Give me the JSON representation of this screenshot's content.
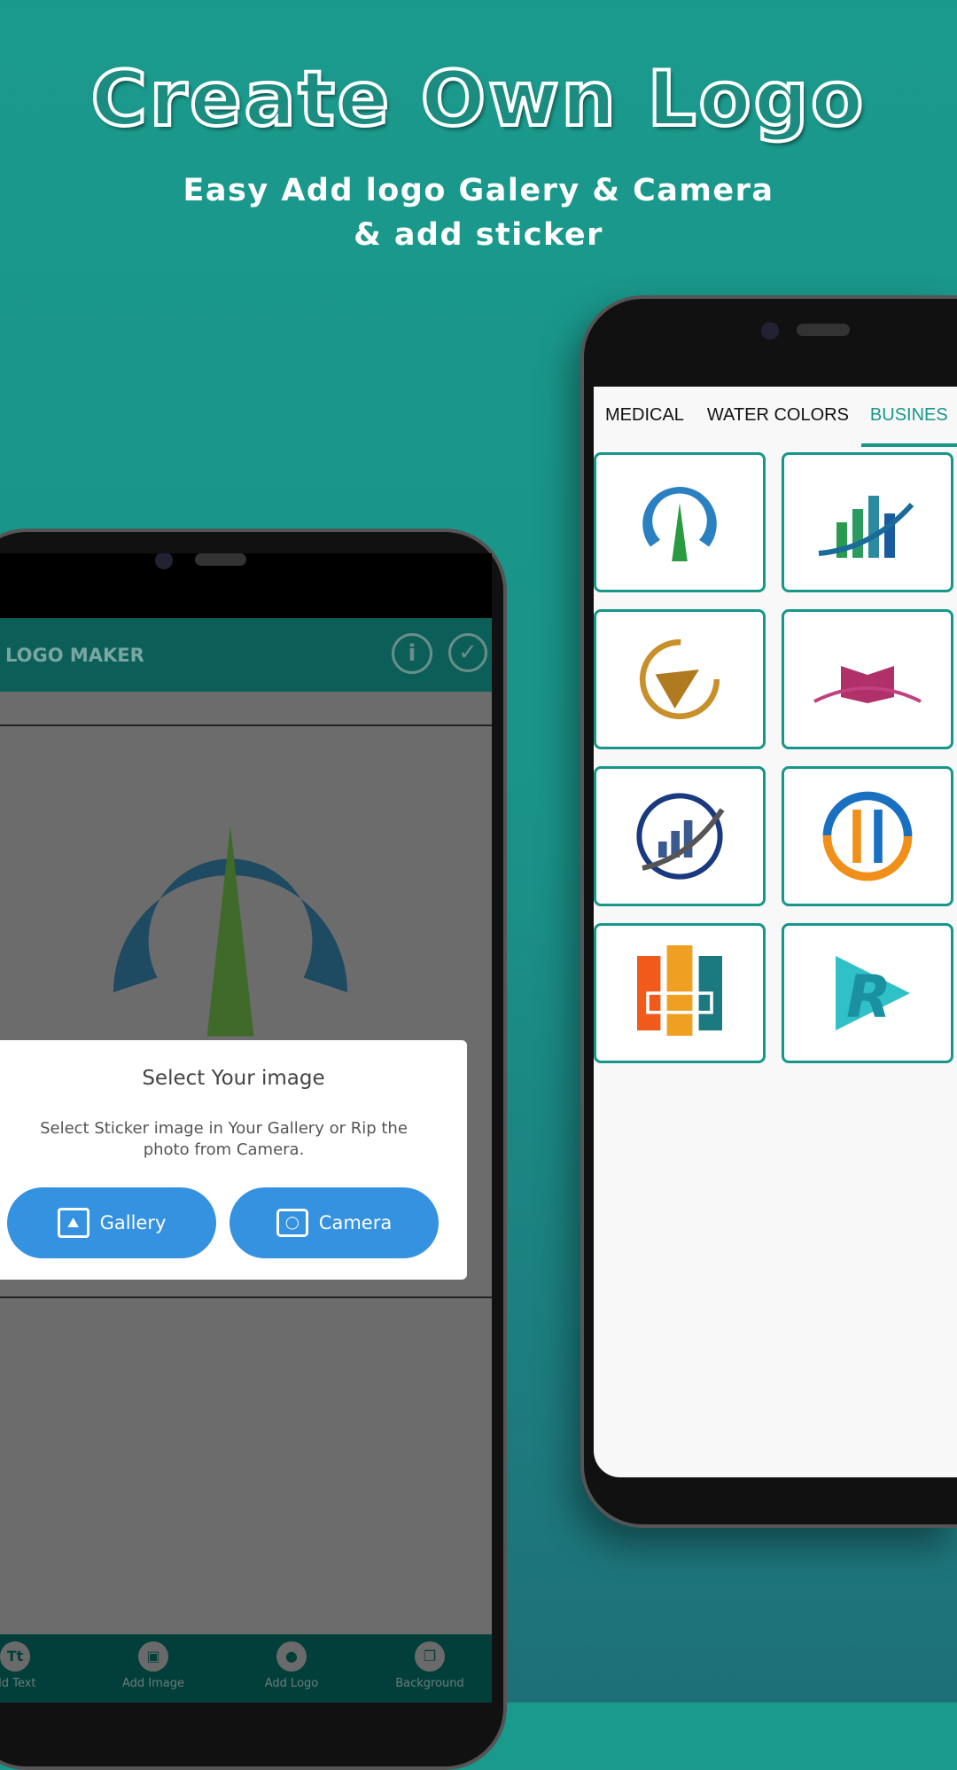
{
  "headline": "Create Own Logo",
  "subtitle_line1": "Easy Add logo Galery & Camera",
  "subtitle_line2": "& add sticker",
  "right_phone": {
    "tabs": [
      {
        "label": "MEDICAL"
      },
      {
        "label": "WATER COLORS"
      },
      {
        "label": "BUSINES"
      }
    ],
    "active_tab": "BUSINES",
    "accent": "#17978a"
  },
  "left_phone": {
    "app_title": "LOGO MAKER",
    "dialog": {
      "title": "Select Your image",
      "message": "Select Sticker image in Your Gallery or Rip the photo from Camera.",
      "gallery_label": "Gallery",
      "camera_label": "Camera"
    },
    "bottom_nav": [
      {
        "label": "dd Text",
        "icon": "text-icon"
      },
      {
        "label": "Add Image",
        "icon": "image-icon"
      },
      {
        "label": "Add Logo",
        "icon": "logo-icon"
      },
      {
        "label": "Background",
        "icon": "layers-icon"
      }
    ],
    "button_color": "#3592e0"
  }
}
